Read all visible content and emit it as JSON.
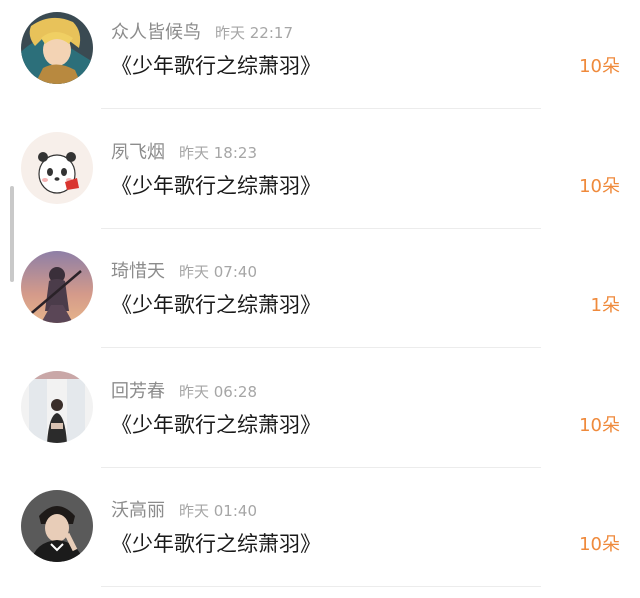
{
  "gifts": [
    {
      "user": "众人皆候鸟",
      "time": "昨天 22:17",
      "title": "《少年歌行之综萧羽》",
      "count": "10朵",
      "avatar": "blonde-anime-character-avatar"
    },
    {
      "user": "夙飞烟",
      "time": "昨天 18:23",
      "title": "《少年歌行之综萧羽》",
      "count": "10朵",
      "avatar": "cartoon-panda-avatar"
    },
    {
      "user": "琦惜天",
      "time": "昨天 07:40",
      "title": "《少年歌行之综萧羽》",
      "count": "1朵",
      "avatar": "anime-swordsman-sunset-avatar"
    },
    {
      "user": "回芳春",
      "time": "昨天 06:28",
      "title": "《少年歌行之综萧羽》",
      "count": "10朵",
      "avatar": "person-in-doorway-avatar"
    },
    {
      "user": "沃高丽",
      "time": "昨天 01:40",
      "title": "《少年歌行之综萧羽》",
      "count": "10朵",
      "avatar": "young-man-portrait-avatar"
    }
  ],
  "colors": {
    "accent": "#ef8a3c",
    "name": "#8c8c8c",
    "time": "#a6a6a6",
    "title": "#1a1a1a"
  }
}
